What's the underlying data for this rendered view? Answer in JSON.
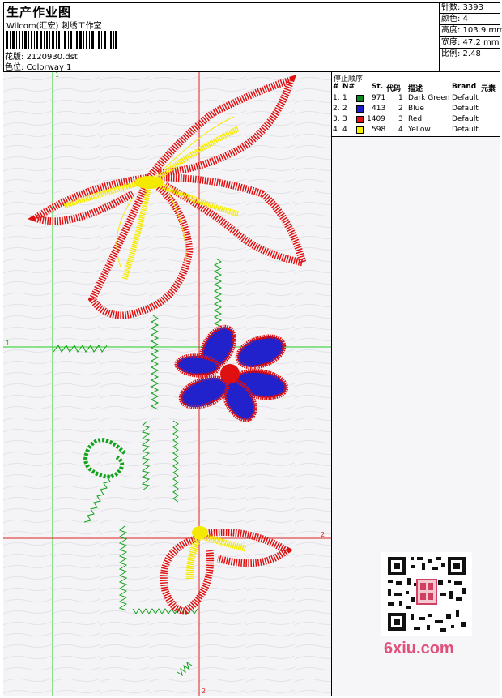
{
  "header": {
    "title": "生产作业图",
    "subtitle": "Wilcom(汇宏) 刺绣工作室",
    "design_label": "花版: 2120930.dst",
    "colorway_label": "色位: Colorway 1"
  },
  "stats": {
    "stitches": "针数: 3393",
    "colors": "颜色: 4",
    "height": "高度: 103.9 mm",
    "width": "宽度: 47.2 mm",
    "scale": "比例: 2.48"
  },
  "stop_sequence": {
    "title": "停止顺序:",
    "columns": [
      "#",
      "N#",
      "St.",
      "代码",
      "描述",
      "Brand",
      "元素"
    ],
    "rows": [
      {
        "num": "1.",
        "n": "1",
        "st": "971",
        "code": "1",
        "desc": "Dark Green",
        "brand": "Default",
        "color": "#0a8a1e"
      },
      {
        "num": "2.",
        "n": "2",
        "st": "413",
        "code": "2",
        "desc": "Blue",
        "brand": "Default",
        "color": "#1a1acc"
      },
      {
        "num": "3.",
        "n": "3",
        "st": "1409",
        "code": "3",
        "desc": "Red",
        "brand": "Default",
        "color": "#e01010"
      },
      {
        "num": "4.",
        "n": "4",
        "st": "598",
        "code": "4",
        "desc": "Yellow",
        "brand": "Default",
        "color": "#f4f000"
      }
    ]
  },
  "guides": {
    "v1_label": "1",
    "h1_label": "1",
    "h2_label": "2",
    "v2_label": "2"
  },
  "watermark": {
    "brand": "6xiu.com"
  },
  "colors": {
    "green_guide": "#22cc22",
    "red_guide": "#dd2222"
  }
}
